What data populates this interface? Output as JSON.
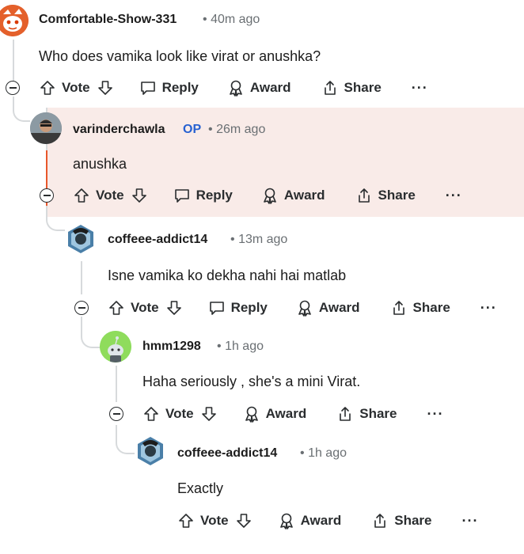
{
  "comments": [
    {
      "user": "Comfortable-Show-331",
      "time": "40m ago",
      "text": "Who does vamika look like virat or anushka?",
      "actions": {
        "vote": "Vote",
        "reply": "Reply",
        "award": "Award",
        "share": "Share",
        "more": "···"
      }
    },
    {
      "user": "varinderchawla",
      "op": "OP",
      "time": "26m ago",
      "text": "anushka",
      "actions": {
        "vote": "Vote",
        "reply": "Reply",
        "award": "Award",
        "share": "Share",
        "more": "···"
      }
    },
    {
      "user": "coffeee-addict14",
      "time": "13m ago",
      "text": "Isne vamika ko dekha nahi hai matlab",
      "actions": {
        "vote": "Vote",
        "reply": "Reply",
        "award": "Award",
        "share": "Share",
        "more": "···"
      }
    },
    {
      "user": "hmm1298",
      "time": "1h ago",
      "text": "Haha seriously , she's a mini Virat.",
      "actions": {
        "vote": "Vote",
        "award": "Award",
        "share": "Share",
        "more": "···"
      }
    },
    {
      "user": "coffeee-addict14",
      "time": "1h ago",
      "text": "Exactly",
      "actions": {
        "vote": "Vote",
        "award": "Award",
        "share": "Share",
        "more": "···"
      }
    }
  ],
  "separator": "•",
  "colors": {
    "op_accent": "#2761d1",
    "highlight_bg": "#f9ebe8",
    "highlight_bar": "#e8572b",
    "meta": "#6a6f73"
  }
}
